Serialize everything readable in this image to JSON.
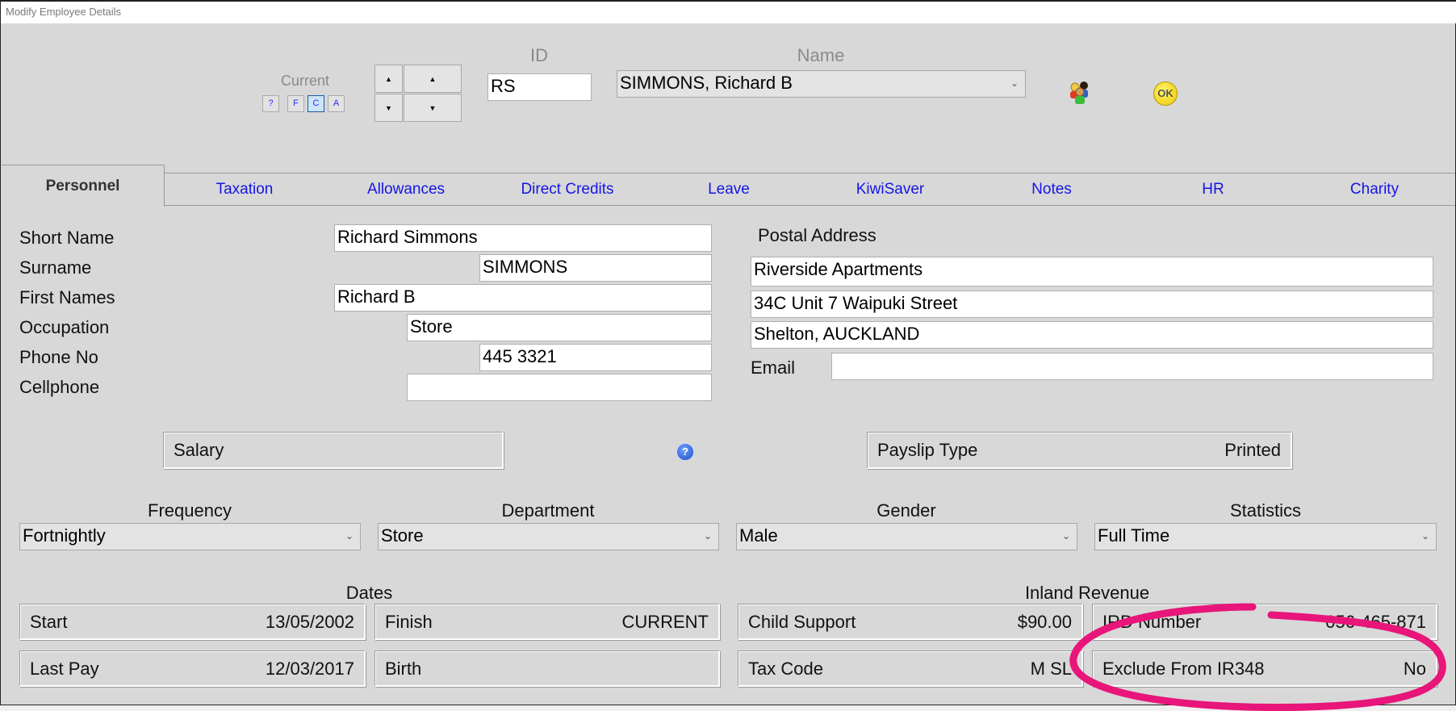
{
  "window": {
    "title": "Modify Employee Details"
  },
  "header": {
    "current_label": "Current",
    "filter_buttons": [
      {
        "label": "?",
        "active": false
      },
      {
        "label": "F",
        "active": false
      },
      {
        "label": "C",
        "active": true
      },
      {
        "label": "A",
        "active": false
      }
    ],
    "nav_arrows": {
      "up": "▲",
      "down": "▼"
    },
    "id_label": "ID",
    "id_value": "RS",
    "name_label": "Name",
    "name_value": "SIMMONS, Richard B",
    "employees_icon": "people-group-icon",
    "ok_label": "OK"
  },
  "tabs": [
    {
      "label": "Personnel",
      "active": true
    },
    {
      "label": "Taxation"
    },
    {
      "label": "Allowances"
    },
    {
      "label": "Direct Credits"
    },
    {
      "label": "Leave"
    },
    {
      "label": "KiwiSaver"
    },
    {
      "label": "Notes"
    },
    {
      "label": "HR"
    },
    {
      "label": "Charity"
    }
  ],
  "personnel": {
    "fields": [
      {
        "label": "Short Name",
        "value": "Richard Simmons"
      },
      {
        "label": "Surname",
        "value": "SIMMONS"
      },
      {
        "label": "First Names",
        "value": "Richard B"
      },
      {
        "label": "Occupation",
        "value": "Store"
      },
      {
        "label": "Phone No",
        "value": "445 3321"
      },
      {
        "label": "Cellphone",
        "value": ""
      }
    ],
    "postal_address_label": "Postal Address",
    "postal_address": [
      "Riverside Apartments",
      "34C Unit 7 Waipuki Street",
      "Shelton, AUCKLAND"
    ],
    "email_label": "Email",
    "email_value": "",
    "salary_label": "Salary",
    "help_icon": "?",
    "payslip_type_label": "Payslip Type",
    "payslip_type_value": "Printed",
    "dropdowns": [
      {
        "label": "Frequency",
        "value": "Fortnightly"
      },
      {
        "label": "Department",
        "value": "Store"
      },
      {
        "label": "Gender",
        "value": "Male"
      },
      {
        "label": "Statistics",
        "value": "Full Time"
      }
    ],
    "chevron": "⌄",
    "dates_label": "Dates",
    "dates": [
      {
        "label": "Start",
        "value": "13/05/2002"
      },
      {
        "label": "Finish",
        "value": "CURRENT"
      },
      {
        "label": "Last Pay",
        "value": "12/03/2017"
      },
      {
        "label": "Birth",
        "value": ""
      }
    ],
    "inland_revenue_label": "Inland Revenue",
    "inland_revenue": [
      {
        "label": "Child Support",
        "value": "$90.00"
      },
      {
        "label": "IRD Number",
        "value": "056-465-871"
      },
      {
        "label": "Tax Code",
        "value": "M SL"
      },
      {
        "label": "Exclude From IR348",
        "value": "No"
      }
    ]
  },
  "annotation": {
    "color": "#e8157a",
    "description": "hand-drawn circle highlighting Exclude From IR348"
  }
}
